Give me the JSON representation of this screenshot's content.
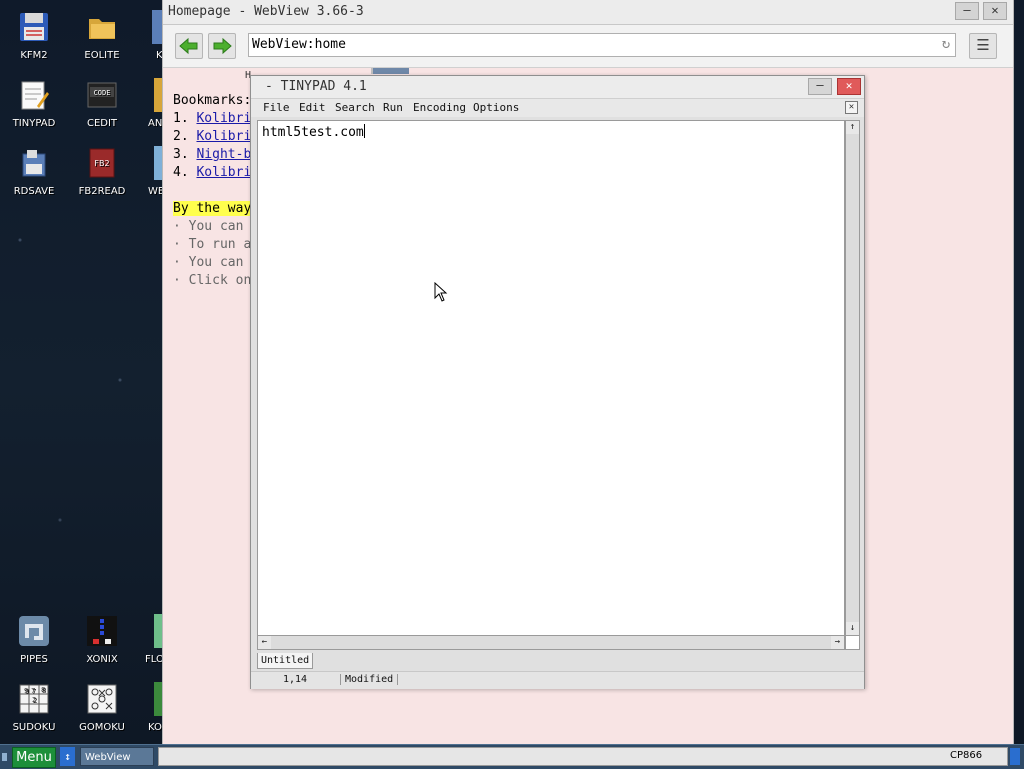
{
  "desktop": {
    "icons": [
      {
        "label": "KFM2"
      },
      {
        "label": "EOLITE"
      },
      {
        "label": "TINYPAD"
      },
      {
        "label": "CEDIT"
      },
      {
        "label": "RDSAVE"
      },
      {
        "label": "FB2READ"
      },
      {
        "label": "PIPES"
      },
      {
        "label": "XONIX"
      },
      {
        "label": "SUDOKU"
      },
      {
        "label": "GOMOKU"
      }
    ],
    "partial_labels": {
      "col3_row1": "K",
      "col3_row2": "AN",
      "col3_row3": "WE",
      "col3_row7": "FLO",
      "col3_row8": "KO"
    }
  },
  "webview": {
    "title": "Homepage - WebView 3.66-3",
    "address": "WebView:home",
    "tab_fragment": "H",
    "content": {
      "bookmarks_heading": "Bookmarks:",
      "bookmarks": [
        {
          "num": "1.",
          "text": "Kolibri"
        },
        {
          "num": "2.",
          "text": "Kolibri"
        },
        {
          "num": "3.",
          "text": "Night-b"
        },
        {
          "num": "4.",
          "text": "Kolibri"
        }
      ],
      "by_the_way": "By the way",
      "tips": [
        "· You can",
        "· To run a",
        "· You can",
        "· Click on"
      ]
    }
  },
  "tinypad": {
    "title": "- TINYPAD 4.1",
    "menu": [
      "File",
      "Edit",
      "Search",
      "Run",
      "Encoding",
      "Options"
    ],
    "editor_text": "html5test.com",
    "tab_label": "Untitled",
    "cursor_pos": "1,14",
    "modified": "Modified"
  },
  "taskbar": {
    "menu_label": "Menu",
    "task_label": "WebView",
    "codepage": "CP866"
  },
  "colors": {
    "webview_bg": "#f8e4e4",
    "link": "#1a1aa8",
    "highlight": "#ffff4d",
    "menu_button": "#1d8f3a"
  }
}
